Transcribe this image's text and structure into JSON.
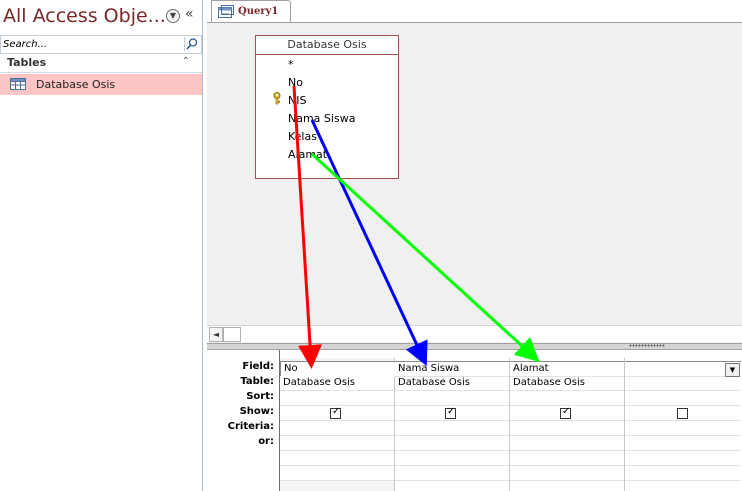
{
  "nav": {
    "title": "All Access Obje...",
    "search_placeholder": "Search...",
    "group_label": "Tables",
    "items": [
      {
        "label": "Database Osis"
      }
    ]
  },
  "tabs": [
    {
      "label": "Query1"
    }
  ],
  "design": {
    "table": {
      "title": "Database Osis",
      "fields": [
        "*",
        "No",
        "NIS",
        "Nama Siswa",
        "Kelas",
        "Alamat"
      ],
      "primary_key": "NIS"
    }
  },
  "grid": {
    "row_labels": [
      "Field:",
      "Table:",
      "Sort:",
      "Show:",
      "Criteria:",
      "or:"
    ],
    "columns": [
      {
        "field": "No",
        "table": "Database Osis",
        "sort": "",
        "show": true
      },
      {
        "field": "Nama Siswa",
        "table": "Database Osis",
        "sort": "",
        "show": true
      },
      {
        "field": "Alamat",
        "table": "Database Osis",
        "sort": "",
        "show": true
      },
      {
        "field": "",
        "table": "",
        "sort": "",
        "show": false
      }
    ]
  },
  "colors": {
    "title": "#7a2727",
    "selected_item": "#fdc5c5",
    "arrow_no": "#ff0000",
    "arrow_nama_siswa": "#0000ff",
    "arrow_alamat": "#00ff00"
  }
}
